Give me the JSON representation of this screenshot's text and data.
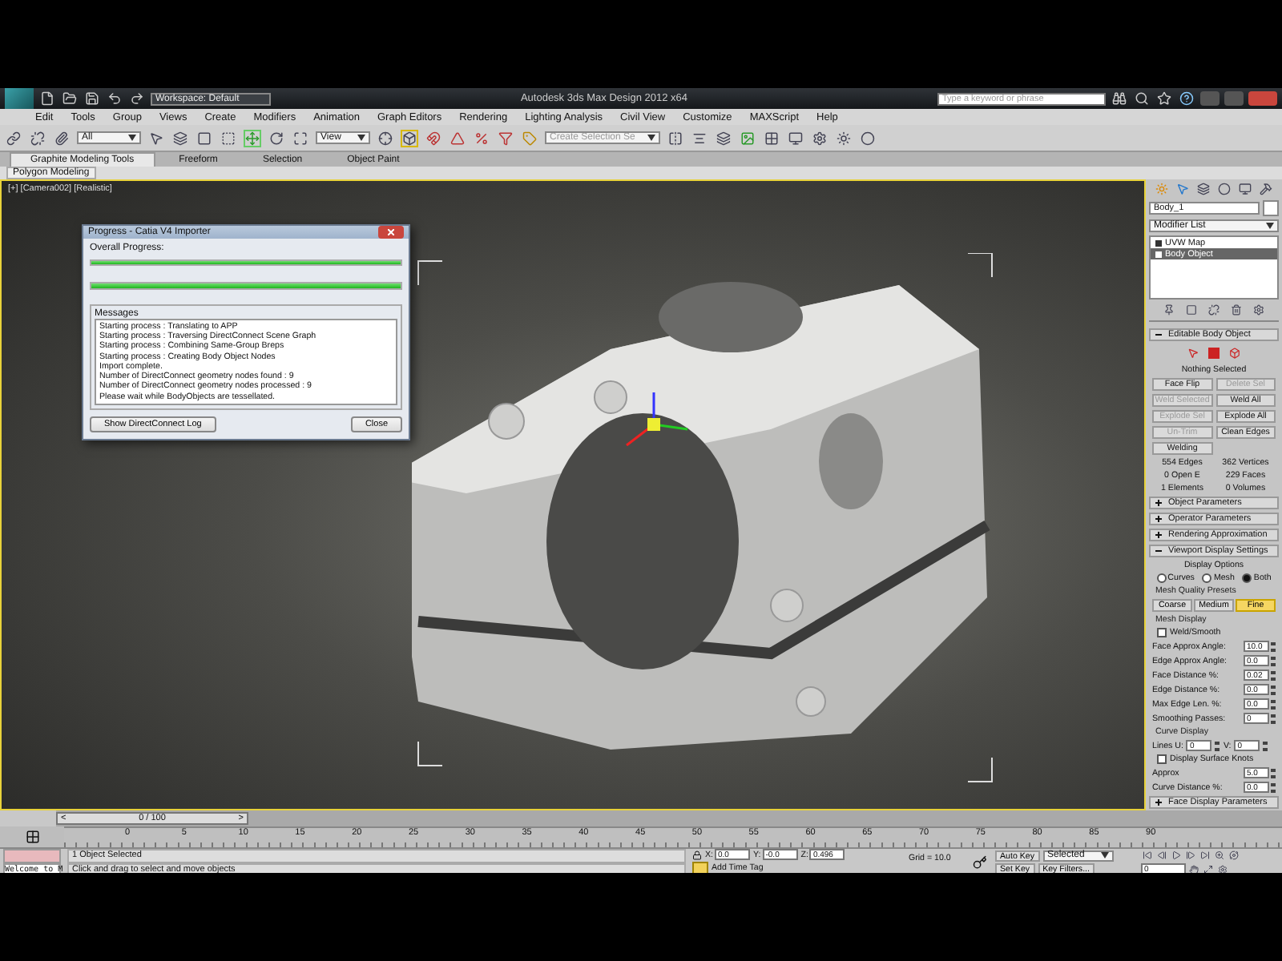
{
  "title_bar": {
    "workspace": "Workspace: Default",
    "title": "Autodesk 3ds Max Design 2012 x64",
    "search": {
      "placeholder": "Type a keyword or phrase"
    }
  },
  "menu": [
    "Edit",
    "Tools",
    "Group",
    "Views",
    "Create",
    "Modifiers",
    "Animation",
    "Graph Editors",
    "Rendering",
    "Lighting Analysis",
    "Civil View",
    "Customize",
    "MAXScript",
    "Help"
  ],
  "toolbar": {
    "selection_filter": "All",
    "reference_coord": "View",
    "named_selection": {
      "placeholder": "Create Selection Se"
    }
  },
  "ribbon": {
    "tabs": [
      {
        "label": "Graphite Modeling Tools",
        "selected": true
      },
      {
        "label": "Freeform",
        "selected": false
      },
      {
        "label": "Selection",
        "selected": false
      },
      {
        "label": "Object Paint",
        "selected": false
      }
    ],
    "panel": "Polygon Modeling"
  },
  "viewport": {
    "label": "[+] [Camera002] [Realistic]"
  },
  "dialog": {
    "title": "Progress - Catia V4 Importer",
    "overall": "Overall Progress:",
    "progress": [
      {
        "level": 1
      },
      {
        "level": 1
      }
    ],
    "messages_title": "Messages",
    "messages": [
      "Starting process : Translating to APP",
      "Starting process : Traversing DirectConnect Scene Graph",
      "Starting process : Combining Same-Group Breps",
      "Starting process : Creating Body Object Nodes",
      "Import complete.",
      "Number of DirectConnect geometry nodes found : 9",
      "Number of DirectConnect geometry nodes processed : 9",
      "Please wait while BodyObjects are tessellated."
    ],
    "buttons": [
      "Show DirectConnect Log",
      "Close"
    ]
  },
  "command_panel": {
    "name": "Body_1",
    "modifier_list": "Modifier List",
    "stack": [
      {
        "label": "UVW Map",
        "selected": false
      },
      {
        "label": "Body Object",
        "selected": true
      }
    ],
    "editable": {
      "label": "Editable Body Object",
      "expanded": true
    },
    "nothing_selected": "Nothing Selected",
    "buttons": [
      {
        "label": "Face Flip",
        "disabled": false
      },
      {
        "label": "Delete Sel",
        "disabled": true
      },
      {
        "label": "Weld Selected",
        "disabled": true
      },
      {
        "label": "Weld All",
        "disabled": false
      },
      {
        "label": "Explode Sel",
        "disabled": true
      },
      {
        "label": "Explode All",
        "disabled": false
      },
      {
        "label": "Un-Trim",
        "disabled": true
      },
      {
        "label": "Clean Edges",
        "disabled": false
      },
      {
        "label": "Welding",
        "disabled": false
      }
    ],
    "stats": [
      "554 Edges",
      "362 Vertices",
      "0 Open E",
      "229 Faces",
      "1 Elements",
      "0 Volumes"
    ],
    "rollouts": [
      {
        "label": "Object Parameters",
        "expanded": false
      },
      {
        "label": "Operator Parameters",
        "expanded": false
      },
      {
        "label": "Rendering Approximation",
        "expanded": false
      },
      {
        "label": "Viewport Display Settings",
        "expanded": true
      }
    ],
    "display_options": {
      "title": "Display Options",
      "options": [
        {
          "label": "Curves",
          "selected": false
        },
        {
          "label": "Mesh",
          "selected": false
        },
        {
          "label": "Both",
          "selected": true
        }
      ]
    },
    "presets": {
      "title": "Mesh Quality Presets",
      "options": [
        {
          "label": "Coarse",
          "selected": false
        },
        {
          "label": "Medium",
          "selected": false
        },
        {
          "label": "Fine",
          "selected": true
        }
      ]
    },
    "mesh_display": {
      "title": "Mesh Display",
      "weld_smooth": {
        "label": "Weld/Smooth",
        "checked": false
      },
      "spinners": [
        {
          "label": "Face Approx Angle:",
          "value": "10.0"
        },
        {
          "label": "Edge Approx Angle:",
          "value": "0.0"
        },
        {
          "label": "Face Distance %:",
          "value": "0.02"
        },
        {
          "label": "Edge Distance %:",
          "value": "0.0"
        },
        {
          "label": "Max Edge Len. %:",
          "value": "0.0"
        },
        {
          "label": "Smoothing Passes:",
          "value": "0"
        }
      ]
    },
    "curve_display": {
      "title": "Curve Display",
      "lines_u": {
        "label": "Lines U:",
        "value": "0"
      },
      "lines_v": {
        "label": "V:",
        "value": "0"
      },
      "knots": {
        "label": "Display Surface Knots",
        "checked": false
      },
      "spinners": [
        {
          "label": "Approx",
          "value": "5.0"
        },
        {
          "label": "Curve Distance %:",
          "value": "0.0"
        }
      ]
    },
    "face_display": {
      "label": "Face Display Parameters",
      "expanded": false
    }
  },
  "timeline": {
    "position": "0 / 100",
    "prev": "<",
    "next": ">",
    "ticks": [
      "0",
      "5",
      "10",
      "15",
      "20",
      "25",
      "30",
      "35",
      "40",
      "45",
      "50",
      "55",
      "60",
      "65",
      "70",
      "75",
      "80",
      "85",
      "90"
    ]
  },
  "status_bar": {
    "welcome": "Welcome to M",
    "selection": "1 Object Selected",
    "prompt": "Click and drag to select and move objects",
    "coords": [
      {
        "label": "X:",
        "value": "0.0"
      },
      {
        "label": "Y:",
        "value": "-0.0"
      },
      {
        "label": "Z:",
        "value": "0.496"
      }
    ],
    "grid": "Grid = 10.0",
    "time_tag": "Add Time Tag",
    "auto_key": "Auto Key",
    "key_mode": "Selected",
    "set_key": "Set Key",
    "key_filters": "Key Filters...",
    "frame": "0"
  }
}
